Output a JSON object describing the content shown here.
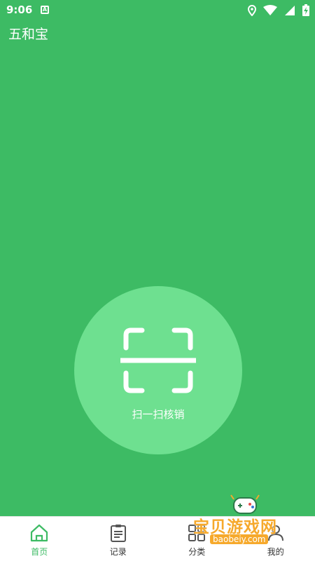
{
  "status": {
    "time": "9:06",
    "notif_letter": "A"
  },
  "app": {
    "title": "五和宝"
  },
  "scan": {
    "label": "扫一扫核销"
  },
  "tabs": [
    {
      "label": "首页",
      "icon": "home-icon",
      "active": true
    },
    {
      "label": "记录",
      "icon": "clipboard-icon",
      "active": false
    },
    {
      "label": "分类",
      "icon": "grid-icon",
      "active": false
    },
    {
      "label": "我的",
      "icon": "person-icon",
      "active": false
    }
  ],
  "watermark": {
    "text": "宝贝游戏网",
    "url": "baobeiy.com"
  },
  "colors": {
    "primary": "#3dbb64",
    "circle": "#6ee090",
    "watermark": "#f6a92c"
  }
}
